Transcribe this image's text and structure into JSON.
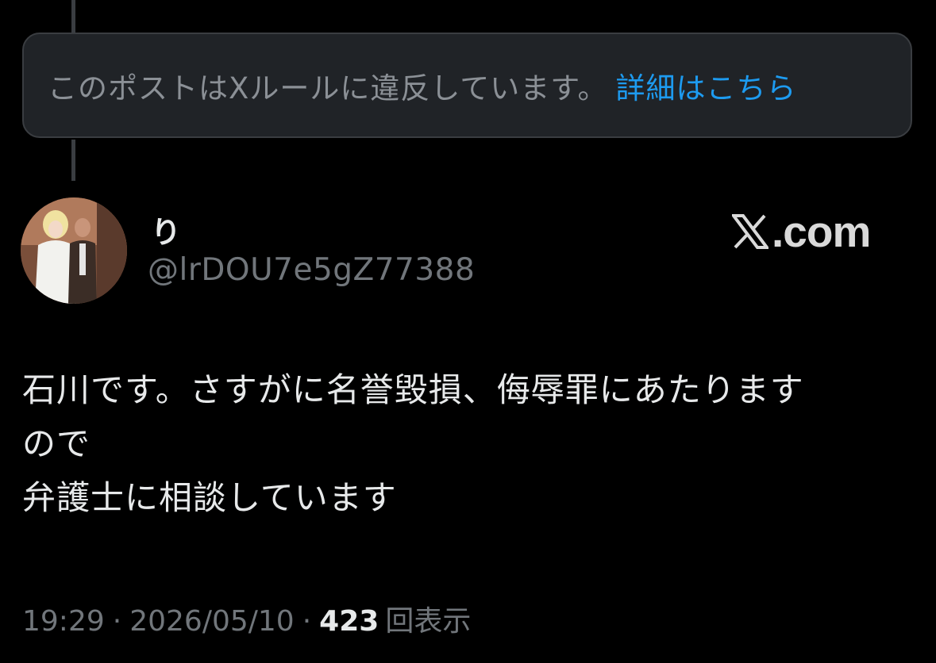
{
  "notice": {
    "message": "このポストはXルールに違反しています。",
    "link": "詳細はこちら"
  },
  "author": {
    "display_name": "り",
    "handle": "@lrDOU7e5gZ77388"
  },
  "brand": {
    "domain": ".com"
  },
  "post": {
    "lines": [
      "石川です。さすがに名誉毀損、侮辱罪にあたります",
      "ので",
      "弁護士に相談しています"
    ]
  },
  "meta": {
    "time": "19:29",
    "separator": "·",
    "date": "2026/05/10",
    "views_count": "423",
    "views_label": "回表示"
  },
  "colors": {
    "background": "#000000",
    "notice_background": "#202327",
    "link": "#1d9bf0",
    "secondary_text": "#71767b",
    "primary_text": "#e7e9ea"
  }
}
